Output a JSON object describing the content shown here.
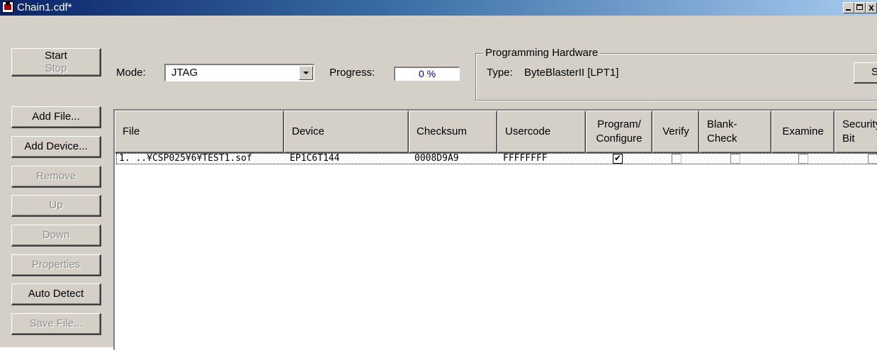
{
  "window": {
    "title": "Chain1.cdf*",
    "min_glyph": "",
    "max_glyph": "",
    "close_glyph": "x"
  },
  "buttons": {
    "start": "Start",
    "stop": "Stop",
    "add_file": "Add File...",
    "add_device": "Add Device...",
    "remove": "Remove",
    "up": "Up",
    "down": "Down",
    "properties": "Properties",
    "auto_detect": "Auto Detect",
    "save_file": "Save File..."
  },
  "mode": {
    "label": "Mode:",
    "value": "JTAG"
  },
  "progress": {
    "label": "Progress:",
    "value": "0 %"
  },
  "hardware": {
    "group_title": "Programming Hardware",
    "type_label": "Type:",
    "type_value": "ByteBlasterII [LPT1]",
    "setup_button": "Setup..."
  },
  "table": {
    "headers": {
      "file": "File",
      "device": "Device",
      "checksum": "Checksum",
      "usercode": "Usercode",
      "program_1": "Program/",
      "program_2": "Configure",
      "verify": "Verify",
      "blank_1": "Blank-",
      "blank_2": "Check",
      "examine": "Examine",
      "security_1": "Security",
      "security_2": "Bit"
    },
    "rows": [
      {
        "file": "1. ..¥CSP025¥6¥TEST1.sof",
        "device": "EP1C6T144",
        "checksum": "0008D9A9",
        "usercode": "FFFFFFFF",
        "program_configure": true,
        "verify": false,
        "blank_check": false,
        "examine": false,
        "security_bit": false,
        "check_glyph": "✔"
      }
    ]
  }
}
